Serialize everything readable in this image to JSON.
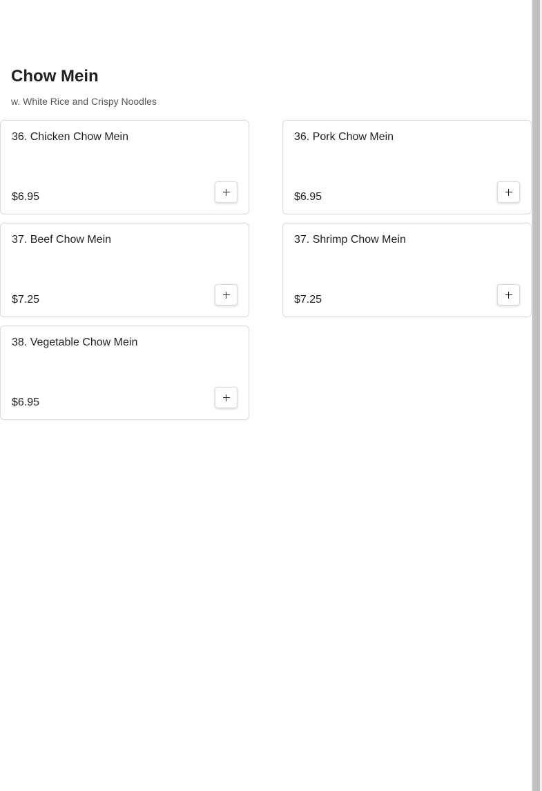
{
  "category": {
    "title": "Chow Mein",
    "subtitle": "w. White Rice and Crispy Noodles"
  },
  "items": [
    {
      "name": "36. Chicken Chow Mein",
      "price": "$6.95",
      "add_icon": "plus-icon"
    },
    {
      "name": "36. Pork Chow Mein",
      "price": "$6.95",
      "add_icon": "plus-icon"
    },
    {
      "name": "37. Beef Chow Mein",
      "price": "$7.25",
      "add_icon": "plus-icon"
    },
    {
      "name": "37. Shrimp Chow Mein",
      "price": "$7.25",
      "add_icon": "plus-icon"
    },
    {
      "name": "38. Vegetable Chow Mein",
      "price": "$6.95",
      "add_icon": "plus-icon"
    }
  ],
  "colors": {
    "text": "#1f1f1f",
    "subtitle": "#555555",
    "card_border": "#d9d9d9",
    "scrollbar_thumb": "#c1c1c1"
  }
}
